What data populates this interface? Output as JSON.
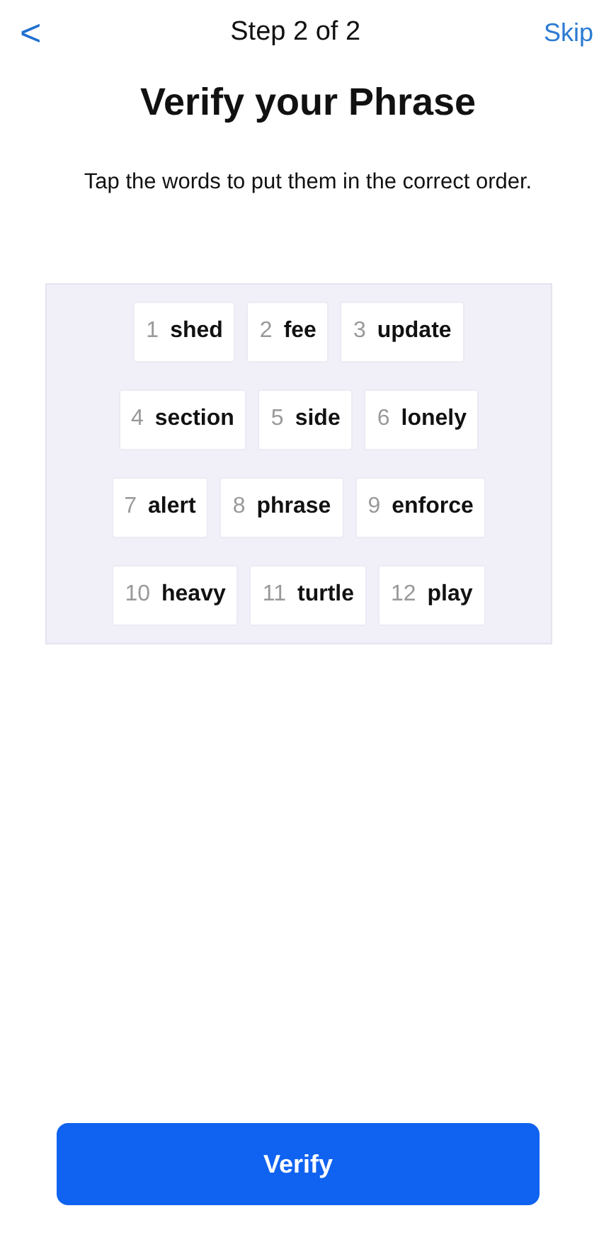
{
  "header": {
    "back": "<",
    "title": "Step 2 of 2",
    "skip": "Skip"
  },
  "heading": "Verify your Phrase",
  "instruction": "Tap the words to put them in the correct order.",
  "word_rows": [
    [
      {
        "number": "1",
        "word": "shed"
      },
      {
        "number": "2",
        "word": "fee"
      },
      {
        "number": "3",
        "word": "update"
      }
    ],
    [
      {
        "number": "4",
        "word": "section"
      },
      {
        "number": "5",
        "word": "side"
      },
      {
        "number": "6",
        "word": "lonely"
      }
    ],
    [
      {
        "number": "7",
        "word": "alert"
      },
      {
        "number": "8",
        "word": "phrase"
      },
      {
        "number": "9",
        "word": "enforce"
      }
    ],
    [
      {
        "number": "10",
        "word": "heavy"
      },
      {
        "number": "11",
        "word": "turtle"
      },
      {
        "number": "12",
        "word": "play"
      }
    ]
  ],
  "verify_button": "Verify"
}
